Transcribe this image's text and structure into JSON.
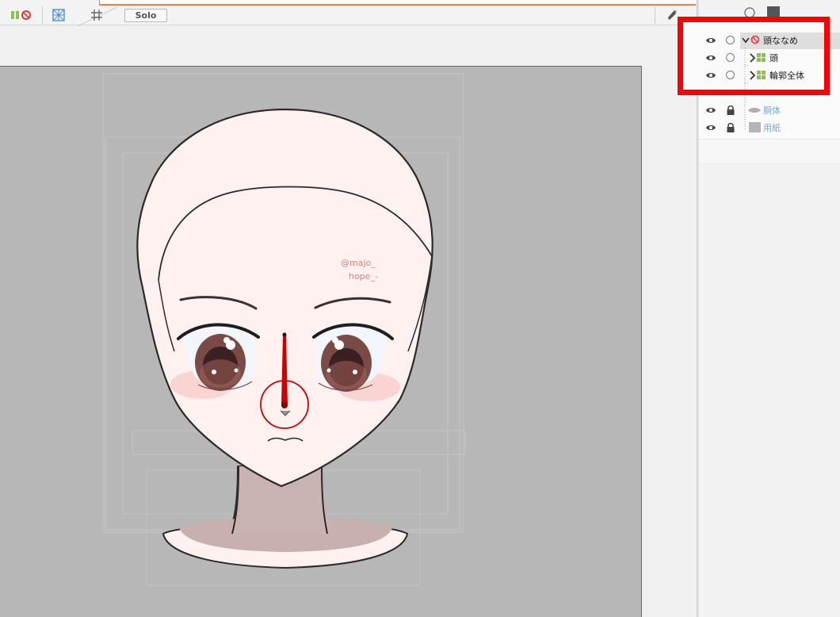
{
  "toolbar": {
    "solo_label": "Solo",
    "icons": [
      "group-color-icon",
      "mesh-edit-icon",
      "grid-icon",
      "pen-icon"
    ]
  },
  "layers": {
    "items": [
      {
        "name": "頭ななめ",
        "type": "folder-rotate",
        "expanded": true,
        "visible": true,
        "locked": false,
        "selected": true
      },
      {
        "name": "頭",
        "type": "part-group",
        "expanded": false,
        "visible": true,
        "locked": false
      },
      {
        "name": "輪郭全体",
        "type": "part-group",
        "expanded": false,
        "visible": true,
        "locked": false
      },
      {
        "name": "胴体",
        "type": "warp",
        "visible": true,
        "locked": true
      },
      {
        "name": "用紙",
        "type": "paper",
        "visible": true,
        "locked": true
      }
    ]
  },
  "canvas": {
    "watermark": [
      "@majo_",
      "hope_-"
    ],
    "background_color": "#b7b7b7"
  },
  "colors": {
    "highlight": "#ff0000",
    "accent_orange": "#f08040",
    "skin": "#fff1ef",
    "layer_dim": "#7fa6cf",
    "rotation_handle": "#cc0000"
  }
}
